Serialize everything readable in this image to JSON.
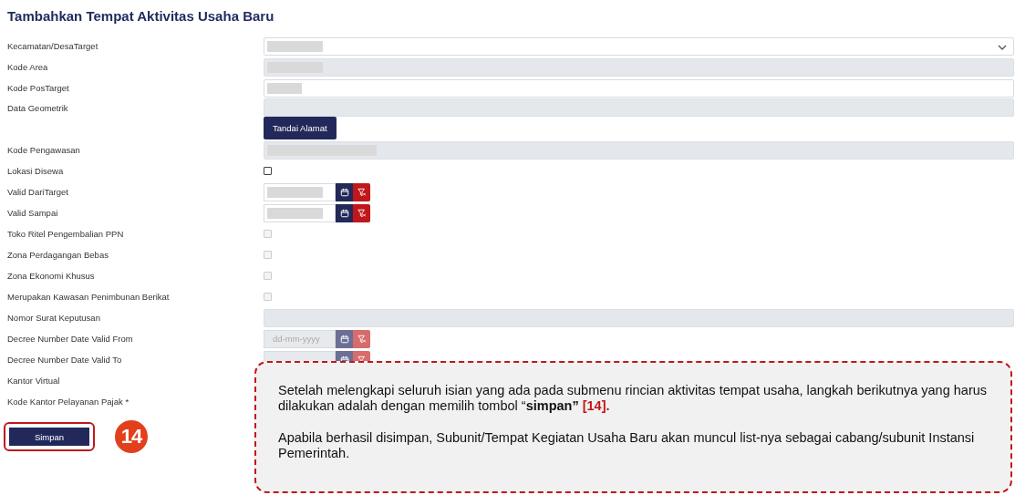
{
  "title": "Tambahkan Tempat Aktivitas Usaha Baru",
  "rows": [
    {
      "label": "Kecamatan/DesaTarget",
      "kind": "select",
      "redacted": true
    },
    {
      "label": "Kode Area",
      "kind": "input",
      "disabled": true,
      "redacted": true
    },
    {
      "label": "Kode PosTarget",
      "kind": "input",
      "disabled": false,
      "redacted": true
    },
    {
      "label": "Data Geometrik",
      "kind": "geo",
      "disabled": true,
      "button": "Tandai Alamat"
    },
    {
      "label": "Kode Pengawasan",
      "kind": "input",
      "disabled": true,
      "redacted": true
    },
    {
      "label": "Lokasi Disewa",
      "kind": "checkbox",
      "disabled": false,
      "checked": false
    },
    {
      "label": "Valid DariTarget",
      "kind": "date",
      "disabled": false,
      "redacted": true
    },
    {
      "label": "Valid Sampai",
      "kind": "date",
      "disabled": false,
      "redacted": true
    },
    {
      "label": "Toko Ritel Pengembalian PPN",
      "kind": "checkbox",
      "disabled": true,
      "checked": false
    },
    {
      "label": "Zona Perdagangan Bebas",
      "kind": "checkbox",
      "disabled": true,
      "checked": false
    },
    {
      "label": "Zona Ekonomi Khusus",
      "kind": "checkbox",
      "disabled": true,
      "checked": false
    },
    {
      "label": "Merupakan Kawasan Penimbunan Berikat",
      "kind": "checkbox",
      "disabled": true,
      "checked": false
    },
    {
      "label": "Nomor Surat Keputusan",
      "kind": "input",
      "disabled": true
    },
    {
      "label": "Decree Number Date Valid From",
      "kind": "date",
      "disabled": true,
      "placeholder": "dd-mm-yyyy"
    },
    {
      "label": "Decree Number Date Valid To",
      "kind": "date",
      "disabled": true
    },
    {
      "label": "Kantor Virtual",
      "kind": "none"
    },
    {
      "label": "Kode Kantor Pelayanan Pajak *",
      "kind": "none"
    }
  ],
  "save_button": "Simpan",
  "step_badge": "14",
  "callout": {
    "paragraph_1": "Setelah melengkapi seluruh isian yang ada pada submenu rincian aktivitas tempat usaha, langkah berikutnya yang harus dilakukan adalah dengan memilih tombol “**simpan”**",
    "reference": "[14].",
    "paragraph_2": "Apabila berhasil disimpan, Subunit/Tempat Kegiatan Usaha Baru akan muncul list-nya sebagai cabang/subunit Instansi Pemerintah."
  }
}
